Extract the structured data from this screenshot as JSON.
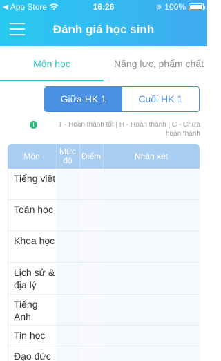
{
  "status_bar": {
    "carrier": "App Store",
    "time": "16:26",
    "battery": "100%"
  },
  "header": {
    "title": "Đánh giá học sinh"
  },
  "tabs": [
    {
      "label": "Môn học",
      "active": true
    },
    {
      "label": "Năng lực, phẩm chất",
      "active": false
    }
  ],
  "segments": [
    {
      "label": "Giữa HK 1",
      "active": true
    },
    {
      "label": "Cuối HK 1",
      "active": false
    }
  ],
  "legend": "T - Hoàn thành tốt | H - Hoàn thành | C - Chưa hoàn thành",
  "table": {
    "headers": [
      "Môn",
      "Mức độ",
      "Điểm",
      "Nhận xét"
    ],
    "rows": [
      {
        "subject": "Tiếng việt",
        "level": "",
        "score": "",
        "comment": ""
      },
      {
        "subject": "Toán học",
        "level": "",
        "score": "",
        "comment": ""
      },
      {
        "subject": "Khoa học",
        "level": "",
        "score": "",
        "comment": ""
      },
      {
        "subject": "Lịch sử & địa lý",
        "level": "",
        "score": "",
        "comment": ""
      },
      {
        "subject": "Tiếng Anh",
        "level": "",
        "score": "",
        "comment": ""
      },
      {
        "subject": "Tin học",
        "level": "",
        "score": "",
        "comment": ""
      },
      {
        "subject": "Đạo đức",
        "level": "",
        "score": "",
        "comment": ""
      }
    ]
  },
  "colors": {
    "header_start": "#27c9f1",
    "header_end": "#41a9ee",
    "tab_active": "#27c2c7",
    "segment_active": "#4a90e2",
    "table_header": "#a9cef2",
    "info_icon": "#2eb873"
  }
}
